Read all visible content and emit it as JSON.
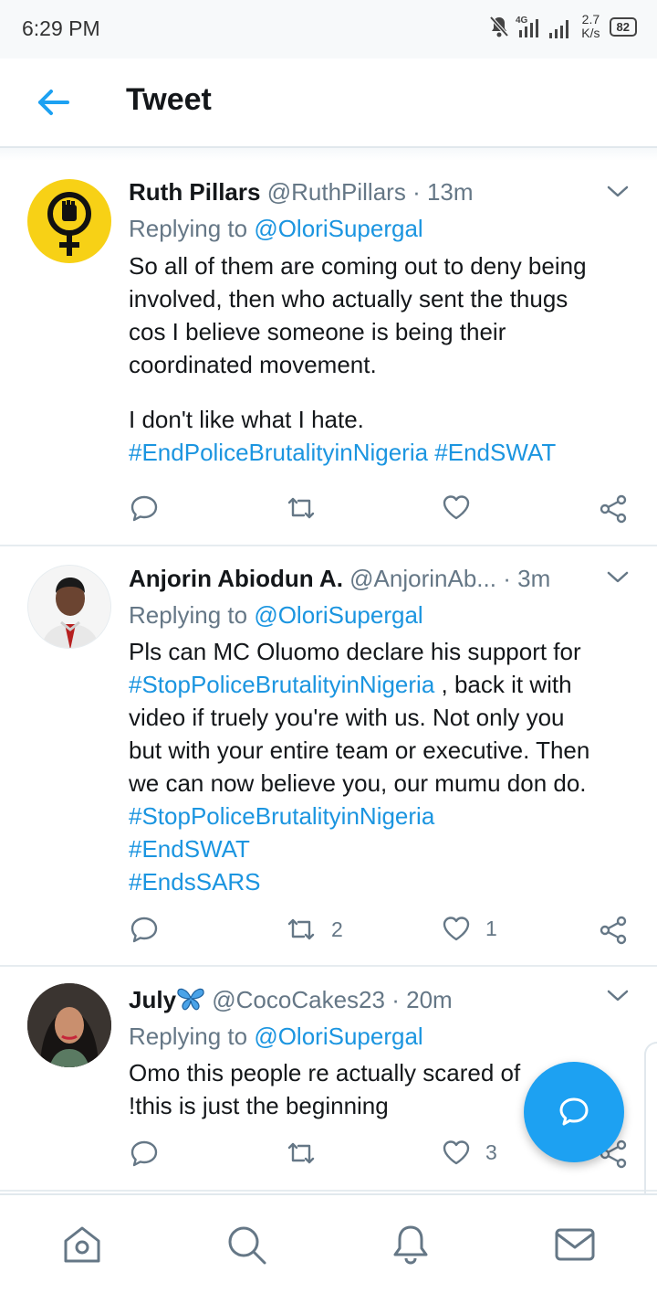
{
  "status_bar": {
    "time": "6:29 PM",
    "network": "4G",
    "speed_value": "2.7",
    "speed_unit": "K/s",
    "battery": "82"
  },
  "header": {
    "title": "Tweet",
    "back_icon": "arrow-left-icon"
  },
  "colors": {
    "accent": "#1DA1F2",
    "link": "#1B95E0",
    "text_primary": "#14171A",
    "text_secondary": "#657786",
    "divider": "#E6ECF0"
  },
  "tweets": [
    {
      "name": "Ruth Pillars",
      "handle": "@RuthPillars",
      "time": "13m",
      "replying_label": "Replying to",
      "replying_to": "@OloriSupergal",
      "lines": [
        "So all of them are coming out to deny being",
        "involved, then who actually sent the thugs",
        "cos I believe someone is being their",
        "coordinated movement.",
        "",
        "I don't like what I hate."
      ],
      "hashtags_line": [
        "#EndPoliceBrutalityinNigeria",
        "#EndSWAT"
      ],
      "retweets": "",
      "likes": ""
    },
    {
      "name": "Anjorin Abiodun A.",
      "handle": "@AnjorinAb...",
      "time": "3m",
      "replying_label": "Replying to",
      "replying_to": "@OloriSupergal",
      "line1": "Pls can MC Oluomo declare his support for",
      "tag_inline": "#StopPoliceBrutalityinNigeria",
      "line2_rest": " , back it with",
      "lines": [
        "video if truely you're with us. Not only you",
        "but with your entire team or executive. Then",
        "we can now believe you, our mumu don do."
      ],
      "tags": [
        "#StopPoliceBrutalityinNigeria",
        "#EndSWAT",
        "#EndsSARS"
      ],
      "retweets": "2",
      "likes": "1"
    },
    {
      "name": "July",
      "name_emoji": "butterfly-icon",
      "handle": "@CocoCakes23",
      "time": "20m",
      "replying_label": "Replying to",
      "replying_to": "@OloriSupergal",
      "lines": [
        "Omo this people re actually scared of",
        "!this is just the beginning"
      ],
      "retweets": "",
      "likes": "3"
    }
  ],
  "bottom_nav": [
    "home-icon",
    "search-icon",
    "notifications-icon",
    "messages-icon"
  ],
  "fab_icon": "compose-reply-icon"
}
